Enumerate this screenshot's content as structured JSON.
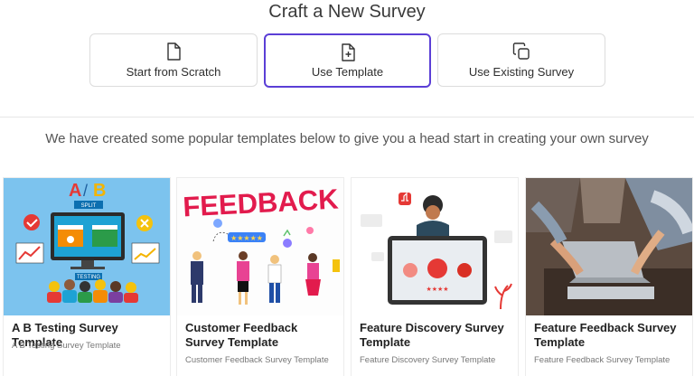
{
  "page_title": "Craft a New Survey",
  "options": [
    {
      "label": "Start from Scratch",
      "icon": "file-icon"
    },
    {
      "label": "Use Template",
      "icon": "file-plus-icon",
      "selected": true
    },
    {
      "label": "Use Existing Survey",
      "icon": "copy-icon"
    }
  ],
  "intro_text": "We have created some popular templates below to give you a head start in creating your own survey",
  "templates": [
    {
      "title": "A B Testing Survey Template",
      "subtitle": "A B Testing Survey Template",
      "thumb_text": {
        "a": "A",
        "slash": "/",
        "b": "B",
        "split": "SPLIT",
        "testing": "TESTING"
      }
    },
    {
      "title": "Customer Feedback Survey Template",
      "subtitle": "Customer Feedback Survey Template",
      "thumb_text": {
        "banner": "FEEDBACK"
      }
    },
    {
      "title": "Feature Discovery Survey Template",
      "subtitle": "Feature Discovery Survey Template"
    },
    {
      "title": "Feature Feedback Survey Template",
      "subtitle": "Feature Feedback Survey Template"
    }
  ],
  "colors": {
    "accent": "#5b3fd6",
    "thumb_blue": "#7cc3ee"
  }
}
